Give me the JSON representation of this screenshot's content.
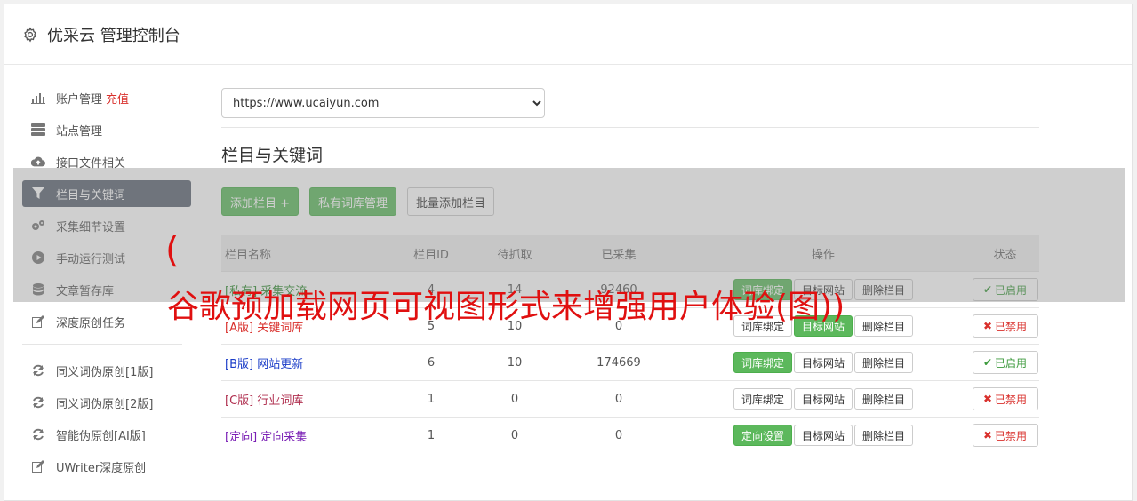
{
  "header": {
    "title": "优采云 管理控制台"
  },
  "sidebar": {
    "items": [
      {
        "label": "账户管理",
        "badge": "充值",
        "icon": "bar-chart-icon"
      },
      {
        "label": "站点管理",
        "icon": "server-icon"
      },
      {
        "label": "接口文件相关",
        "icon": "cloud-upload-icon"
      },
      {
        "label": "栏目与关键词",
        "icon": "filter-icon",
        "active": true
      },
      {
        "label": "采集细节设置",
        "icon": "cogs-icon"
      },
      {
        "label": "手动运行测试",
        "icon": "play-circle-icon"
      },
      {
        "label": "文章暂存库",
        "icon": "database-icon"
      },
      {
        "label": "深度原创任务",
        "icon": "edit-icon"
      },
      {
        "label": "同义词伪原创[1版]",
        "icon": "refresh-icon"
      },
      {
        "label": "同义词伪原创[2版]",
        "icon": "refresh-icon"
      },
      {
        "label": "智能伪原创[AI版]",
        "icon": "refresh-icon"
      },
      {
        "label": "UWriter深度原创",
        "icon": "edit-icon"
      }
    ]
  },
  "main": {
    "site_select": {
      "value": "https://www.ucaiyun.com"
    },
    "section_title": "栏目与关键词",
    "buttons": {
      "add_column": "添加栏目 +",
      "private_lexicon": "私有词库管理",
      "batch_add": "批量添加栏目"
    },
    "table": {
      "headers": [
        "栏目名称",
        "栏目ID",
        "待抓取",
        "已采集",
        "操作",
        "状态"
      ],
      "rows": [
        {
          "tag": "[私有]",
          "name": "采集交流",
          "id": "4",
          "pending": "14",
          "collected": "92460",
          "op1": "词库绑定",
          "op2": "目标网站",
          "op3": "删除栏目",
          "status": "已启用",
          "tag_color": "#2e8b2e",
          "op1_green": true,
          "status_on": true
        },
        {
          "tag": "[A版]",
          "name": "关键词库",
          "id": "5",
          "pending": "10",
          "collected": "0",
          "op1": "词库绑定",
          "op2": "目标网站",
          "op3": "删除栏目",
          "status": "已禁用",
          "tag_color": "#d9302c",
          "op1_green": false,
          "op2_green": true,
          "status_on": false
        },
        {
          "tag": "[B版]",
          "name": "网站更新",
          "id": "6",
          "pending": "10",
          "collected": "174669",
          "op1": "词库绑定",
          "op2": "目标网站",
          "op3": "删除栏目",
          "status": "已启用",
          "tag_color": "#1a3cc8",
          "op1_green": true,
          "status_on": true
        },
        {
          "tag": "[C版]",
          "name": "行业词库",
          "id": "1",
          "pending": "0",
          "collected": "0",
          "op1": "词库绑定",
          "op2": "目标网站",
          "op3": "删除栏目",
          "status": "已禁用",
          "tag_color": "#b03050",
          "op1_green": false,
          "status_on": false
        },
        {
          "tag": "[定向]",
          "name": "定向采集",
          "id": "1",
          "pending": "0",
          "collected": "0",
          "op1": "定向设置",
          "op2": "目标网站",
          "op3": "删除栏目",
          "status": "已禁用",
          "tag_color": "#7a1fb5",
          "op1_green": true,
          "status_on": false
        }
      ]
    }
  },
  "overlay": {
    "paren": "(",
    "text": "谷歌预加载网页可视图形式来增强用户体验(图))"
  },
  "colors": {
    "green": "#5cb85c",
    "red": "#d9302c",
    "active_sidebar": "#5a6270"
  }
}
